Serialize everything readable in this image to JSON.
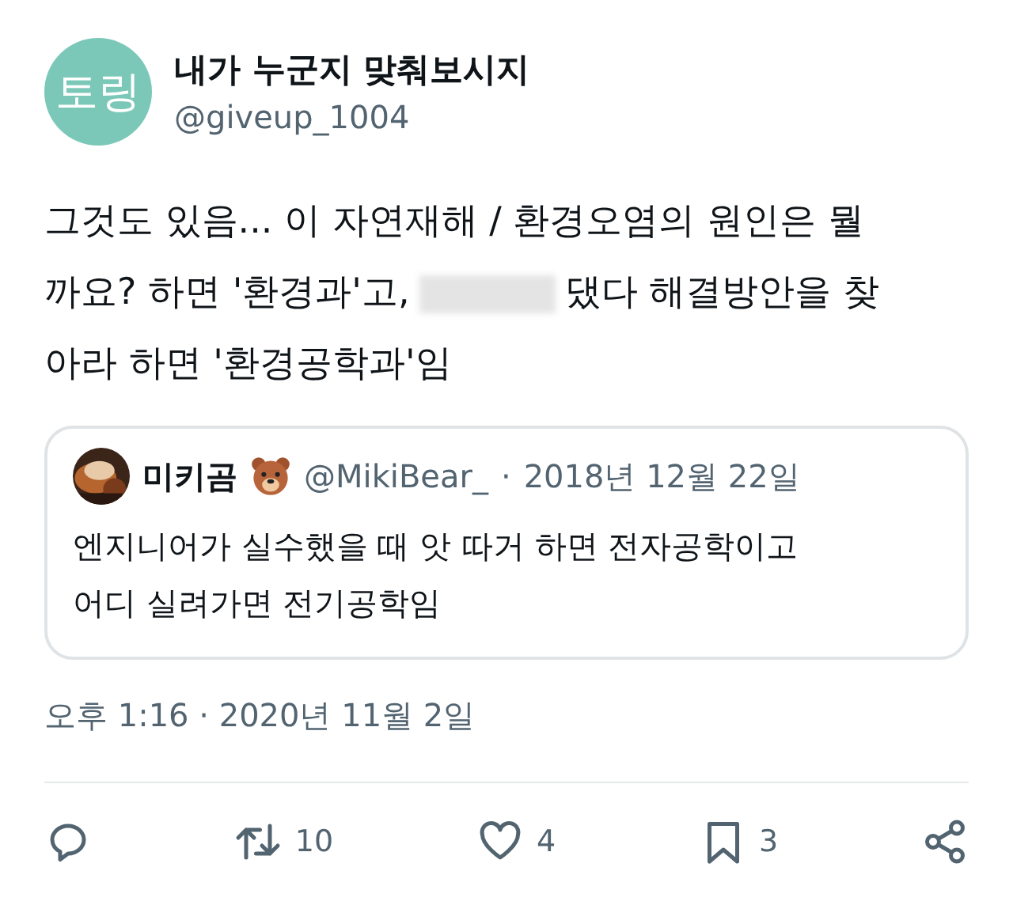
{
  "author": {
    "avatar_text": "토링",
    "name": "내가 누군지 맞춰보시지",
    "handle": "@giveup_1004"
  },
  "body": [
    {
      "text": "그것도 있음... 이 자연재해 / 환경오염의 원인은 뭘"
    },
    {
      "text": "까요? 하면 '환경과'고,",
      "blurred": true,
      "after_blur": "댔다 해결방안을 찾"
    },
    {
      "text": "아라 하면 '환경공학과'임"
    }
  ],
  "quote": {
    "name": "미키곰",
    "handle": "@MikiBear_",
    "separator": "·",
    "date": "2018년 12월 22일",
    "lines": [
      "엔지니어가 실수했을 때 앗 따거 하면 전자공학이고",
      "어디 실려가면 전기공학임"
    ]
  },
  "timestamp": "오후 1:16 · 2020년 11월 2일",
  "actions": [
    {
      "kind": "reply"
    },
    {
      "kind": "repost",
      "count": "10"
    },
    {
      "kind": "like",
      "count": "4"
    },
    {
      "kind": "bookmark",
      "count": "3"
    },
    {
      "kind": "share"
    }
  ]
}
